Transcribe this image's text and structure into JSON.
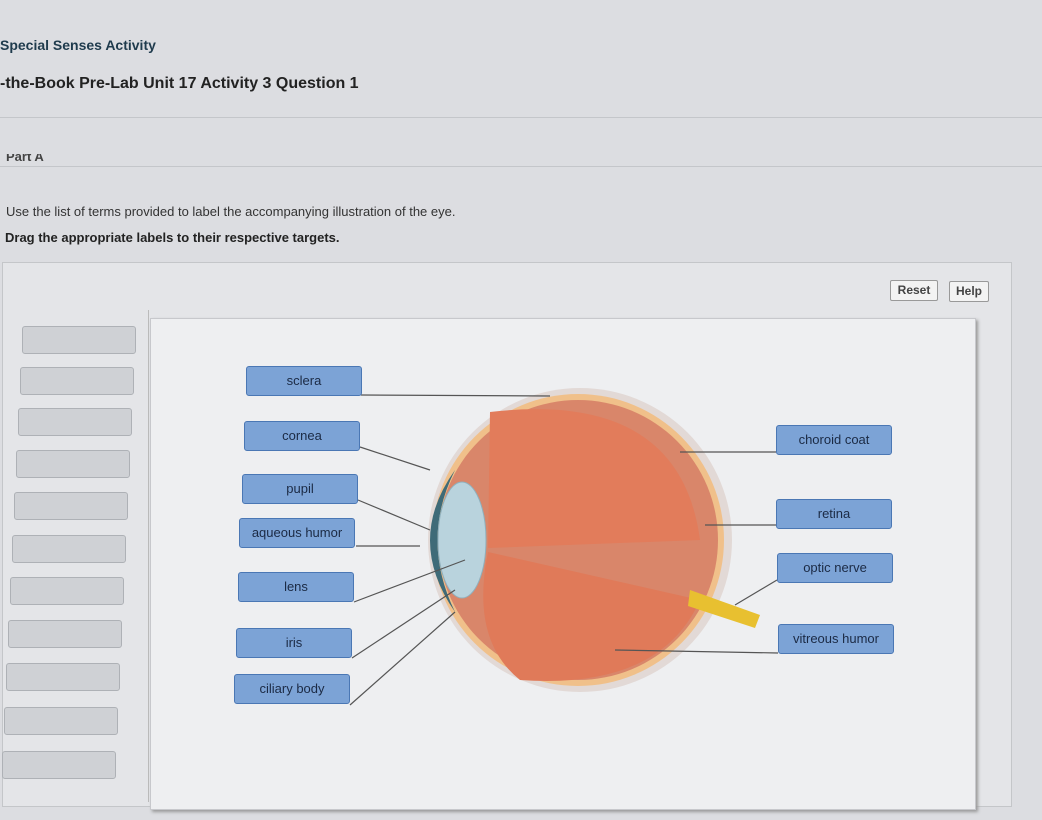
{
  "header": {
    "activity": "Special Senses Activity",
    "question": "-the-Book Pre-Lab Unit 17 Activity 3 Question 1",
    "part": "Part A"
  },
  "instructions": {
    "line1": "Use the list of terms provided to label the accompanying illustration of the eye.",
    "line2": "Drag the appropriate labels to their respective targets."
  },
  "toolbar": {
    "reset": "Reset",
    "help": "Help"
  },
  "labels": {
    "sclera": "sclera",
    "cornea": "cornea",
    "pupil": "pupil",
    "aqueous_humor": "aqueous humor",
    "lens": "lens",
    "iris": "iris",
    "ciliary_body": "ciliary body",
    "choroid_coat": "choroid coat",
    "retina": "retina",
    "optic_nerve": "optic nerve",
    "vitreous_humor": "vitreous humor"
  },
  "colors": {
    "label_fill": "#7ca3d6",
    "eye_interior": "#e07a5a",
    "optic_nerve": "#e8c030"
  }
}
